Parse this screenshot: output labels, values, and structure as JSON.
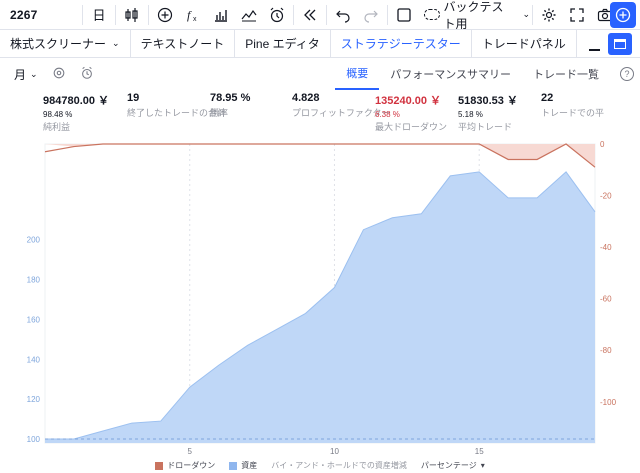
{
  "toolbar": {
    "symbol": "2267",
    "interval": "日",
    "backtest_label": "バックテスト用",
    "icons": [
      "bar-style-icon",
      "plus-circle-icon",
      "fx-icon",
      "chart-bars-icon",
      "indicator-icon",
      "alarm-icon",
      "rewind-icon",
      "undo-icon",
      "redo-icon",
      "square-icon",
      "cloud-icon",
      "gear-icon",
      "fullscreen-icon",
      "camera-icon",
      "add-icon"
    ]
  },
  "tabs": [
    {
      "label": "株式スクリーナー",
      "has_dropdown": true
    },
    {
      "label": "テキストノート"
    },
    {
      "label": "Pine エディタ"
    },
    {
      "label": "ストラテジーテスター",
      "active": true
    },
    {
      "label": "トレードパネル"
    }
  ],
  "tester": {
    "period": "月",
    "tabs": [
      "概要",
      "パフォーマンスサマリー",
      "トレード一覧"
    ],
    "help": "?"
  },
  "stats": [
    {
      "value": "984780.00 ￥",
      "pct": "98.48 %",
      "label": "純利益"
    },
    {
      "value": "19",
      "pct": "",
      "label": "終了したトレードの合計"
    },
    {
      "value": "78.95 %",
      "pct": "",
      "label": "勝率"
    },
    {
      "value": "4.828",
      "pct": "",
      "label": "プロフィットファクター"
    },
    {
      "value": "135240.00 ￥",
      "pct": "6.38 %",
      "label": "最大ドローダウン",
      "color": "#d1323f"
    },
    {
      "value": "51830.53 ￥",
      "pct": "5.18 %",
      "label": "平均トレード"
    },
    {
      "value": "22",
      "pct": "",
      "label": "トレードでの平"
    }
  ],
  "chart_data": {
    "type": "area",
    "x": [
      1,
      2,
      3,
      4,
      5,
      6,
      7,
      8,
      9,
      10,
      11,
      12,
      13,
      14,
      15,
      16,
      17,
      18,
      19
    ],
    "x_ticks": [
      5,
      10,
      15
    ],
    "xlim": [
      0,
      19
    ],
    "series": [
      {
        "name": "資産",
        "axis": "left",
        "color": "#bbd5f6",
        "values": [
          100,
          104,
          108,
          109,
          126,
          137,
          147,
          155,
          163,
          176,
          205,
          211,
          213,
          232,
          234,
          221,
          221,
          234,
          214
        ]
      },
      {
        "name": "ドローダウン",
        "axis": "right",
        "color": "#e8b1a6",
        "values": [
          -1,
          0,
          0,
          0,
          0,
          0,
          0,
          0,
          0,
          0,
          0,
          0,
          0,
          0,
          0,
          -6,
          -6,
          0,
          -9
        ]
      }
    ],
    "left_axis": {
      "ylim": [
        98,
        248
      ],
      "ticks": [
        100,
        120,
        140,
        160,
        180,
        200
      ]
    },
    "right_axis": {
      "ylim": [
        -116,
        0
      ],
      "ticks": [
        0,
        -20,
        -40,
        -60,
        -80,
        -100
      ]
    },
    "baseline": 100,
    "grid": true
  },
  "legend": [
    {
      "label": "ドローダウン",
      "color": "#c9735f"
    },
    {
      "label": "資産",
      "color": "#8fb6ee"
    },
    {
      "label": "バイ・アンド・ホールドでの資産増減"
    }
  ],
  "scale_selector": "パーセンテージ"
}
